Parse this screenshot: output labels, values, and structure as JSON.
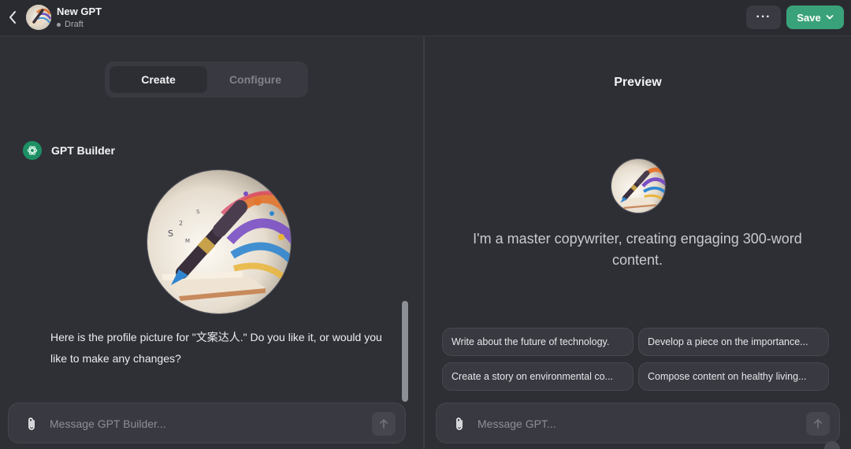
{
  "header": {
    "title": "New GPT",
    "status": "Draft",
    "more_label": "···",
    "save_label": "Save"
  },
  "tabs": [
    {
      "label": "Create",
      "active": true
    },
    {
      "label": "Configure",
      "active": false
    }
  ],
  "builder": {
    "name": "GPT Builder",
    "message": "Here is the profile picture for \"文案达人.\" Do you like it, or would you like to make any changes?"
  },
  "left_composer": {
    "placeholder": "Message GPT Builder..."
  },
  "preview": {
    "title": "Preview",
    "description": "I'm a master copywriter, creating engaging 300-word content.",
    "starters": [
      "Write about the future of technology.",
      "Develop a piece on the importance...",
      "Create a story on environmental co...",
      "Compose content on healthy living..."
    ],
    "composer_placeholder": "Message GPT..."
  },
  "colors": {
    "accent_green": "#3aa27a",
    "background": "#2f3036"
  },
  "icons": {
    "back": "chevron-left-icon",
    "attach": "paperclip-icon",
    "send": "arrow-up-icon",
    "builder": "openai-logo-icon"
  }
}
